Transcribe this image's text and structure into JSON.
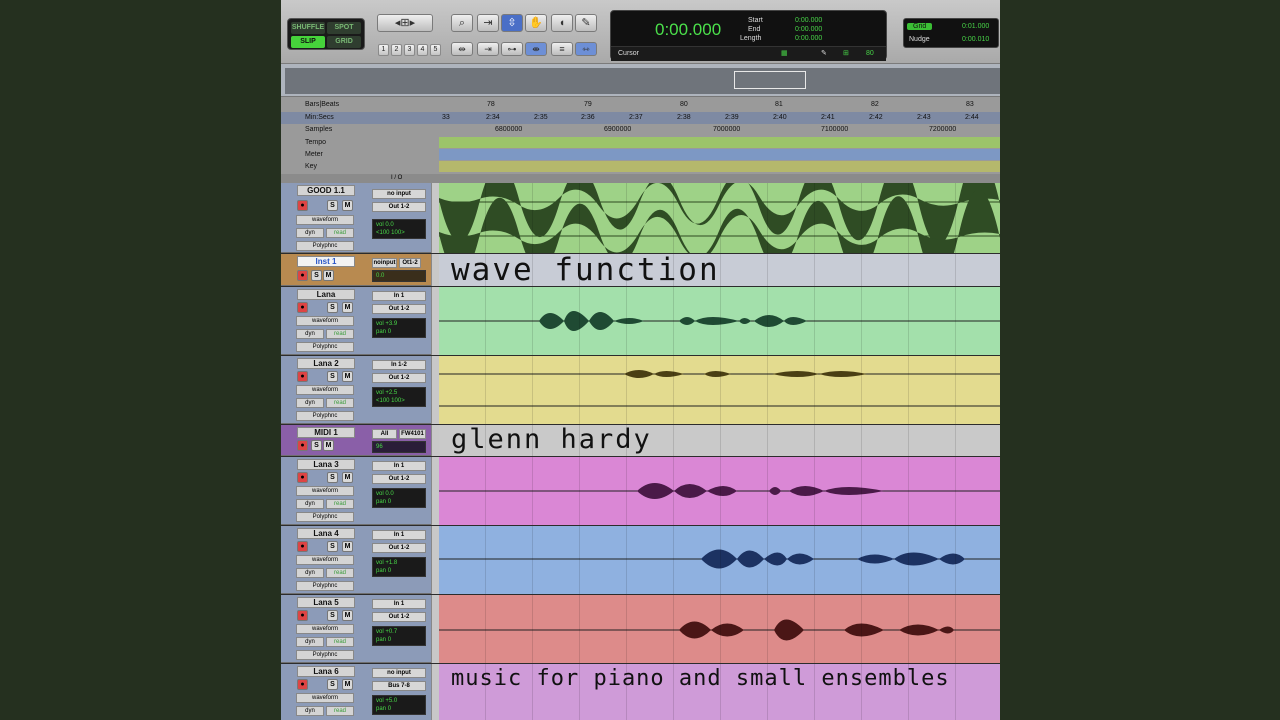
{
  "edit_modes": {
    "shuffle": "SHUFFLE",
    "spot": "SPOT",
    "slip": "SLIP",
    "grid": "GRID"
  },
  "zoom_presets": [
    "1",
    "2",
    "3",
    "4",
    "5"
  ],
  "counter": {
    "main": "0:00.000",
    "start_label": "Start",
    "end_label": "End",
    "length_label": "Length",
    "start": "0:00.000",
    "end": "0:00.000",
    "length": "0:00.000",
    "cursor_label": "Cursor",
    "value": "80"
  },
  "grid": {
    "label": "Grid",
    "value": "0:01.000",
    "nudge_label": "Nudge",
    "nudge_value": "0:00.010"
  },
  "rulers": {
    "bars_label": "Bars|Beats",
    "minsecs_label": "Min:Secs",
    "samples_label": "Samples",
    "tempo_label": "Tempo",
    "meter_label": "Meter",
    "key_label": "Key",
    "bars": [
      "78",
      "79",
      "80",
      "81",
      "82",
      "83"
    ],
    "mins": [
      "33",
      "2:34",
      "2:35",
      "2:36",
      "2:37",
      "2:38",
      "2:39",
      "2:40",
      "2:41",
      "2:42",
      "2:43",
      "2:44"
    ],
    "samples": [
      "6800000",
      "6900000",
      "7000000",
      "7100000",
      "7200000"
    ]
  },
  "io_header": "I / O",
  "tracks": [
    {
      "name": "GOOD 1.1",
      "input": "no input",
      "output": "Out 1-2",
      "view": "waveform",
      "auto": "read",
      "plugin": "Polyphnc",
      "vol": "0.0",
      "pan": "<100  100>",
      "color": "#9ed287"
    },
    {
      "name": "Inst 1",
      "input": "noinput",
      "output": "Ot1-2",
      "vol": "0.0",
      "overlay": "wave function",
      "color": "#c8ccd6"
    },
    {
      "name": "Lana",
      "input": "In 1",
      "output": "Out 1-2",
      "view": "waveform",
      "auto": "read",
      "plugin": "Polyphnc",
      "vol": "+3.9",
      "pan": "0",
      "color": "#a3e0ab"
    },
    {
      "name": "Lana 2",
      "input": "In 1-2",
      "output": "Out 1-2",
      "view": "waveform",
      "auto": "read",
      "plugin": "Polyphnc",
      "vol": "+2.5",
      "pan": "<100  100>",
      "color": "#e3db8f"
    },
    {
      "name": "MIDI 1",
      "input": "All",
      "output": "FW4101",
      "vol": "96",
      "overlay": "glenn hardy",
      "color": "#c9c9c9"
    },
    {
      "name": "Lana 3",
      "input": "In 1",
      "output": "Out 1-2",
      "view": "waveform",
      "auto": "read",
      "plugin": "Polyphnc",
      "vol": "0.0",
      "pan": "0",
      "color": "#da87d5"
    },
    {
      "name": "Lana 4",
      "input": "In 1",
      "output": "Out 1-2",
      "view": "waveform",
      "auto": "read",
      "plugin": "Polyphnc",
      "vol": "+1.8",
      "pan": "0",
      "color": "#8fb1e0"
    },
    {
      "name": "Lana 5",
      "input": "In 1",
      "output": "Out 1-2",
      "view": "waveform",
      "auto": "read",
      "plugin": "Polyphnc",
      "vol": "+0.7",
      "pan": "0",
      "color": "#dd8b8a"
    },
    {
      "name": "Lana 6",
      "input": "no input",
      "output": "Bus 7-8",
      "view": "waveform",
      "auto": "read",
      "plugin": "Polyphnc",
      "vol": "+5.0",
      "pan": "0",
      "overlay": "music for piano and small ensembles",
      "color": "#cf9bd8"
    }
  ]
}
